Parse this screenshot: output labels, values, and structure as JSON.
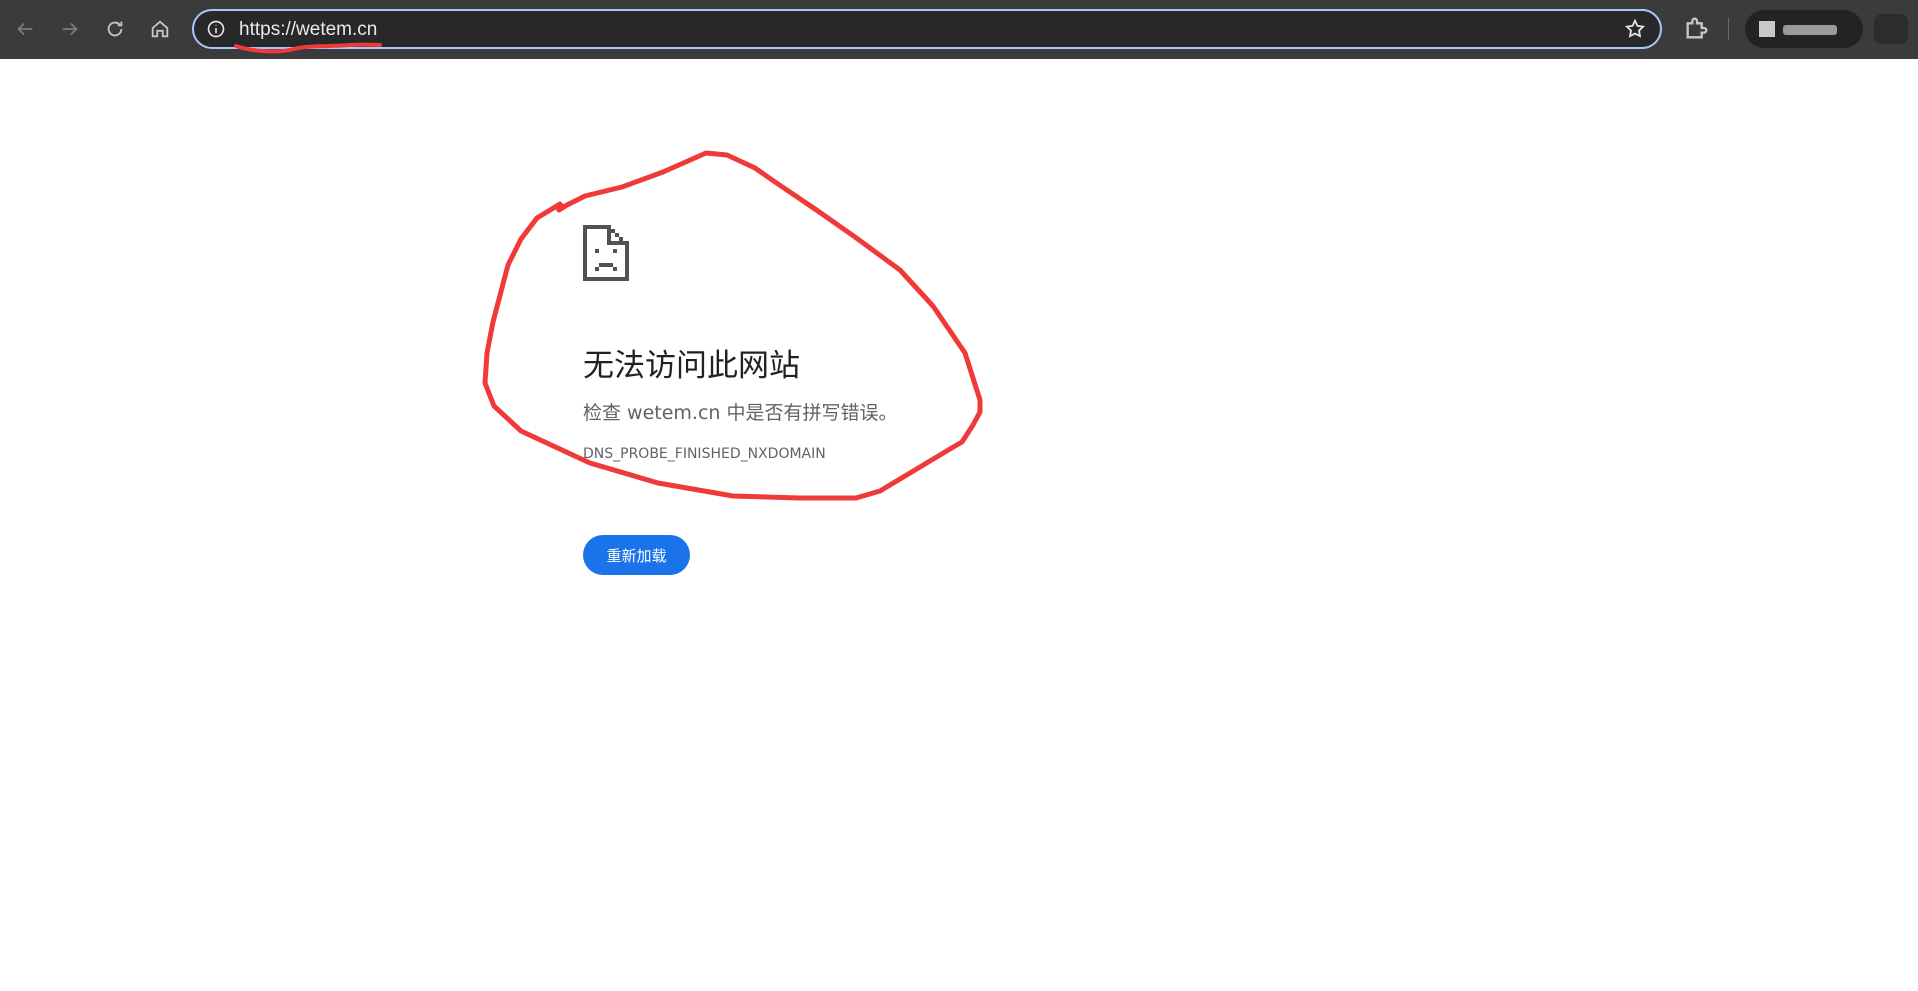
{
  "browser": {
    "url": "https://wetem.cn"
  },
  "error_page": {
    "title": "无法访问此网站",
    "description": "检查 wetem.cn 中是否有拼写错误。",
    "error_code": "DNS_PROBE_FINISHED_NXDOMAIN",
    "reload_label": "重新加载"
  },
  "colors": {
    "toolbar_bg": "#3b3b3b",
    "omnibox_border": "#a8c7fa",
    "button_blue": "#1a73e8",
    "annotation_red": "#f03a3a"
  }
}
